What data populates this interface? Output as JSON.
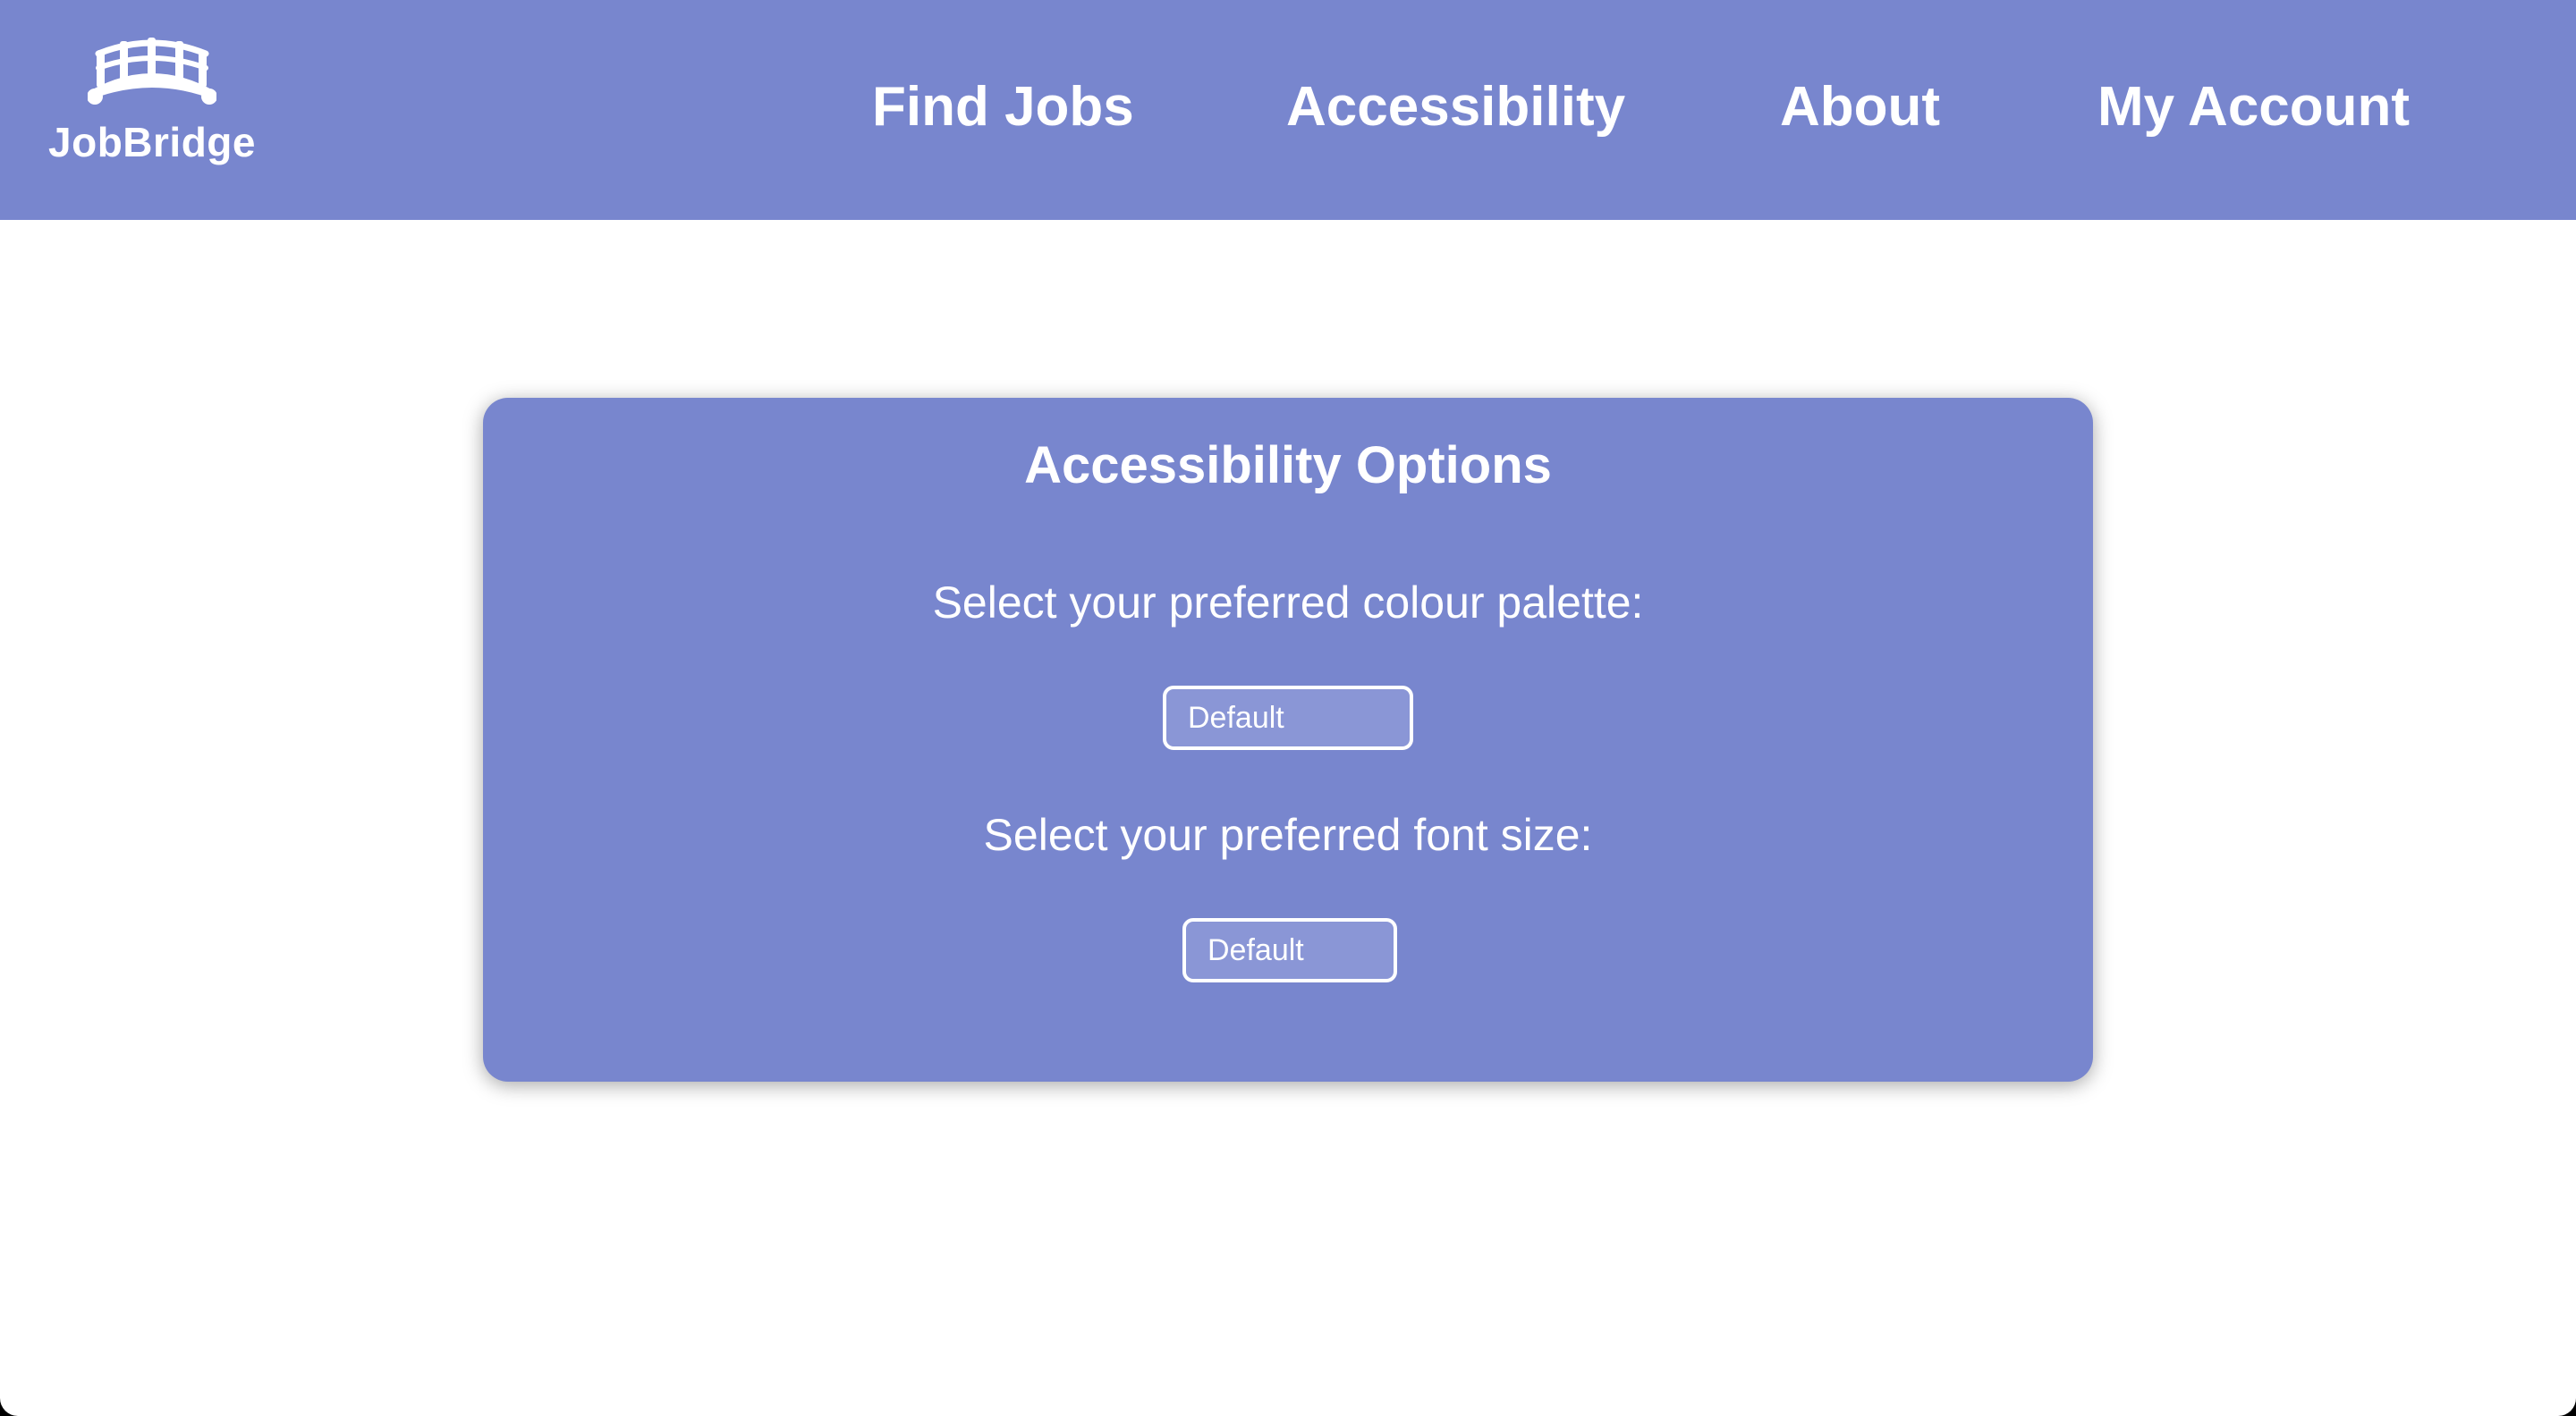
{
  "brand": {
    "name": "JobBridge",
    "logo_icon": "bridge-icon"
  },
  "nav": {
    "items": [
      {
        "label": "Find Jobs"
      },
      {
        "label": "Accessibility"
      },
      {
        "label": "About"
      },
      {
        "label": "My Account"
      }
    ]
  },
  "accessibility": {
    "title": "Accessibility Options",
    "palette": {
      "label": "Select your preferred colour palette:",
      "value": "Default"
    },
    "font_size": {
      "label": "Select your preferred font size:",
      "value": "Default"
    }
  },
  "colors": {
    "accent": "#7886ce",
    "background": "#ffffff",
    "text_on_accent": "#ffffff"
  }
}
